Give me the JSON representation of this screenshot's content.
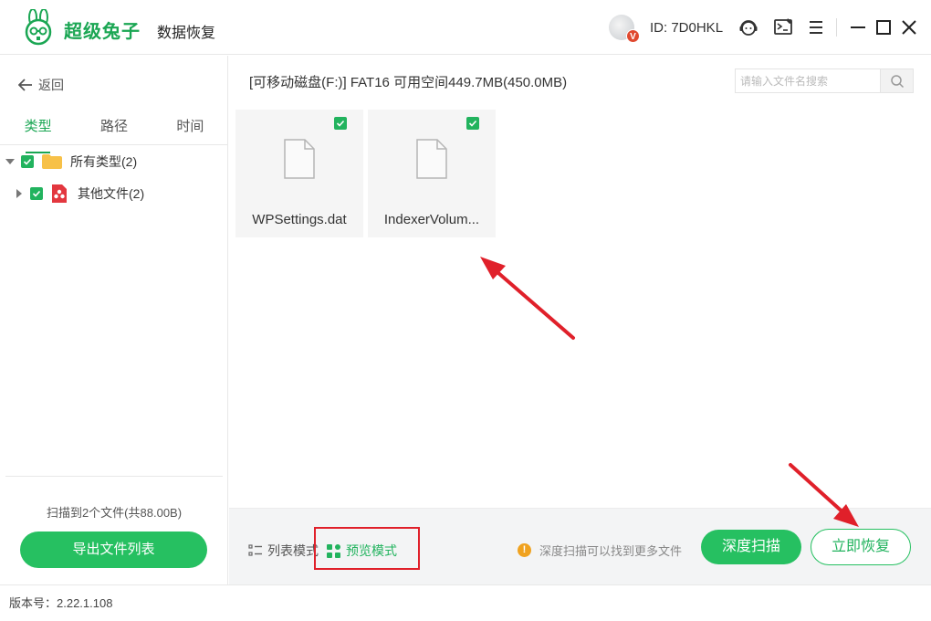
{
  "header": {
    "brand": "超级兔子",
    "brand_sub": "数据恢复",
    "user_id": "ID: 7D0HKL",
    "vip_badge": "V"
  },
  "sidebar": {
    "back_label": "返回",
    "tabs": [
      {
        "label": "类型",
        "active": true
      },
      {
        "label": "路径",
        "active": false
      },
      {
        "label": "时间",
        "active": false
      }
    ],
    "tree": [
      {
        "label": "所有类型(2)",
        "checked": true,
        "icon": "folder-icon"
      },
      {
        "label": "其他文件(2)",
        "checked": true,
        "icon": "other-file-icon"
      }
    ],
    "scan_summary": "扫描到2个文件(共88.00B)",
    "export_label": "导出文件列表"
  },
  "main": {
    "path": "[可移动磁盘(F:)] FAT16 可用空间449.7MB(450.0MB)",
    "search_placeholder": "请输入文件名搜索",
    "files": [
      {
        "name": "WPSettings.dat",
        "checked": true
      },
      {
        "name": "IndexerVolum...",
        "checked": true
      }
    ],
    "view_list_label": "列表模式",
    "view_preview_label": "预览模式",
    "tip": "深度扫描可以找到更多文件",
    "tip_icon": "!",
    "deep_scan_label": "深度扫描",
    "recover_label": "立即恢复"
  },
  "footer": {
    "version": "版本号：2.22.1.108"
  },
  "colors": {
    "accent": "#26c061",
    "annotation": "#e0202a"
  }
}
